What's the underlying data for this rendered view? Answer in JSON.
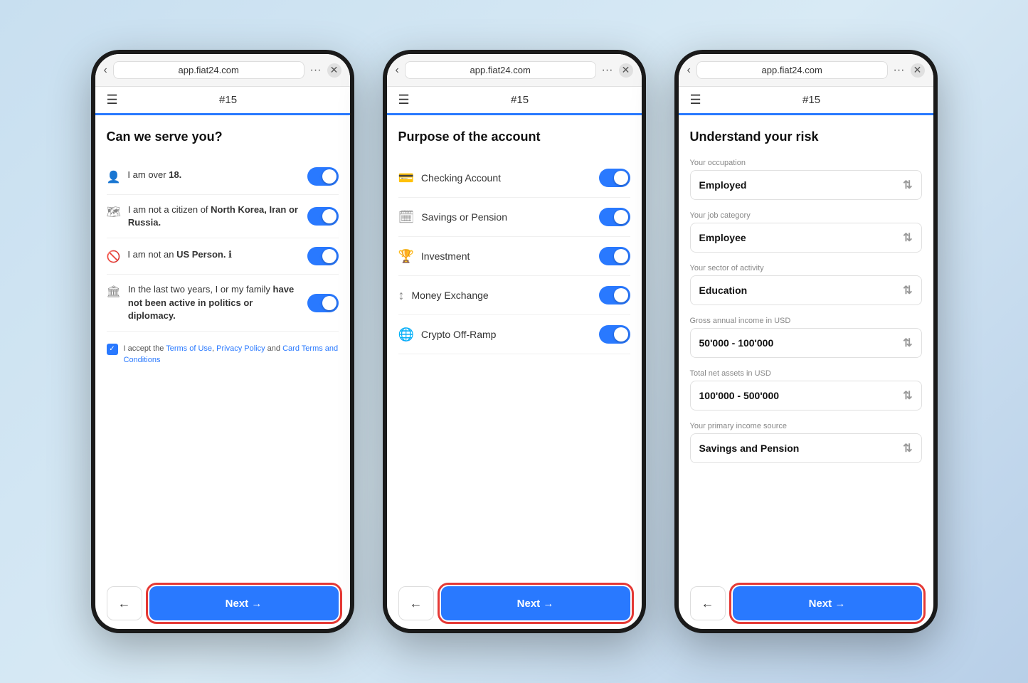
{
  "colors": {
    "accent": "#2979ff",
    "danger": "#e53935",
    "text_primary": "#111",
    "text_secondary": "#333",
    "text_muted": "#888"
  },
  "browser": {
    "back_icon": "‹",
    "url": "app.fiat24.com",
    "dots": "···",
    "close": "✕"
  },
  "nav": {
    "hamburger": "☰",
    "title": "#15"
  },
  "screen1": {
    "title": "Can we serve you?",
    "rows": [
      {
        "icon": "👤",
        "text": "I am over <strong>18.</strong>"
      },
      {
        "icon": "🗺",
        "text": "I am not a citizen of <strong>North Korea, Iran or Russia.</strong>"
      },
      {
        "icon": "🚫",
        "text": "I am not an <strong>US Person.</strong> ℹ"
      },
      {
        "icon": "🏛",
        "text": "In the last two years, I or my family <strong>have not been active in politics or diplomacy.</strong>"
      }
    ],
    "checkbox_text": "I accept the Terms of Use, Privacy Policy and Card Terms and Conditions",
    "back_icon": "←",
    "next_label": "Next →"
  },
  "screen2": {
    "title": "Purpose of the account",
    "rows": [
      {
        "icon": "💳",
        "label": "Checking Account"
      },
      {
        "icon": "🗓",
        "label": "Savings or Pension"
      },
      {
        "icon": "🏆",
        "label": "Investment"
      },
      {
        "icon": "↕",
        "label": "Money Exchange"
      },
      {
        "icon": "🌐",
        "label": "Crypto Off-Ramp"
      }
    ],
    "back_icon": "←",
    "next_label": "Next →"
  },
  "screen3": {
    "title": "Understand your risk",
    "fields": [
      {
        "label": "Your occupation",
        "value": "Employed"
      },
      {
        "label": "Your job category",
        "value": "Employee"
      },
      {
        "label": "Your sector of activity",
        "value": "Education"
      },
      {
        "label": "Gross annual income in USD",
        "value": "50'000 - 100'000"
      },
      {
        "label": "Total net assets in USD",
        "value": "100'000 - 500'000"
      },
      {
        "label": "Your primary income source",
        "value": "Savings and Pension"
      }
    ],
    "back_icon": "←",
    "next_label": "Next →"
  }
}
